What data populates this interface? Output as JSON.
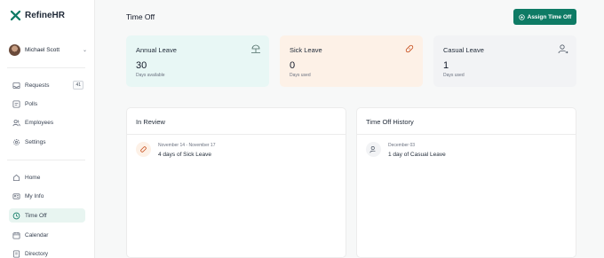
{
  "app": {
    "name": "RefineHR",
    "brand_color": "#0e7b65"
  },
  "user": {
    "name": "Michael Scott"
  },
  "nav_primary": [
    {
      "label": "Requests",
      "icon": "inbox-icon",
      "badge": "41"
    },
    {
      "label": "Polls",
      "icon": "poll-icon"
    },
    {
      "label": "Employees",
      "icon": "users-icon"
    },
    {
      "label": "Settings",
      "icon": "gear-icon"
    }
  ],
  "nav_secondary": [
    {
      "label": "Home",
      "icon": "home-icon"
    },
    {
      "label": "My Info",
      "icon": "id-card-icon"
    },
    {
      "label": "Time Off",
      "icon": "clock-icon",
      "active": true
    },
    {
      "label": "Calendar",
      "icon": "calendar-icon"
    },
    {
      "label": "Directory",
      "icon": "directory-icon"
    }
  ],
  "header": {
    "title": "Time Off",
    "assign_button": "Assign Time Off"
  },
  "cards": {
    "annual": {
      "title": "Annual Leave",
      "value": "30",
      "sub": "Days available",
      "color": "#e8f7f5"
    },
    "sick": {
      "title": "Sick Leave",
      "value": "0",
      "sub": "Days used",
      "color": "#fdf1e7"
    },
    "casual": {
      "title": "Casual Leave",
      "value": "1",
      "sub": "Days used",
      "color": "#f2f3f5"
    }
  },
  "in_review": {
    "title": "In Review",
    "entries": [
      {
        "date": "November 14 - November 17",
        "text": "4 days of Sick Leave",
        "icon": "sick-leave-icon"
      }
    ]
  },
  "history": {
    "title": "Time Off History",
    "entries": [
      {
        "date": "December 03",
        "text": "1 day of Casual Leave",
        "icon": "casual-leave-icon"
      }
    ]
  }
}
